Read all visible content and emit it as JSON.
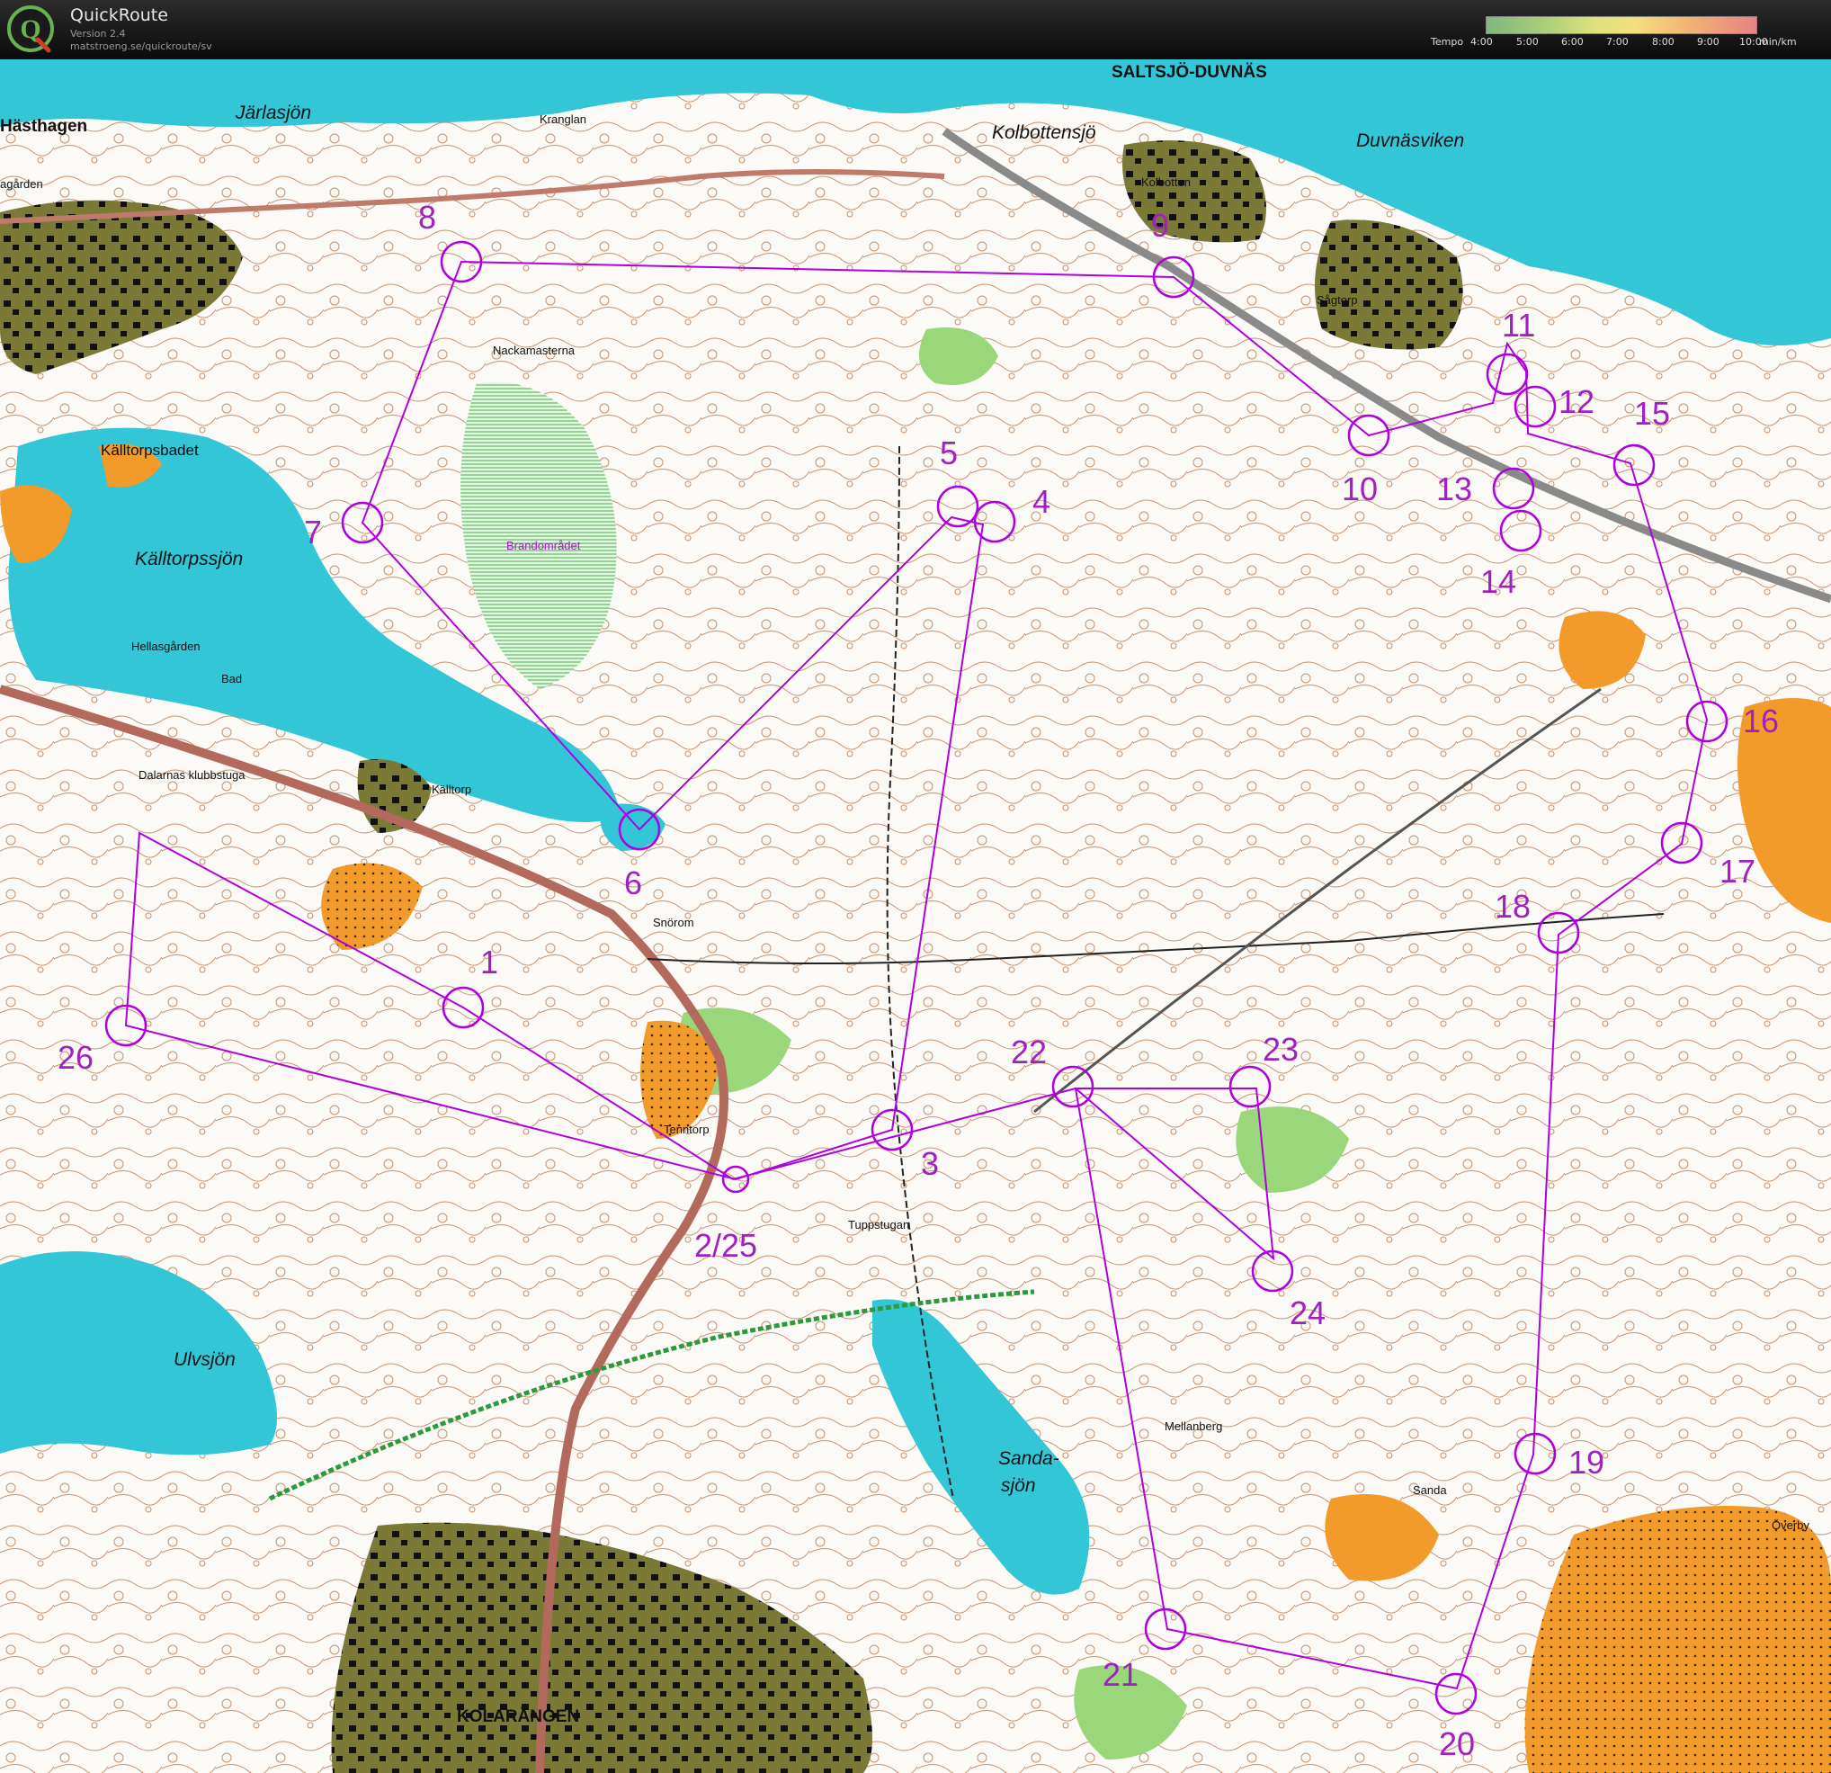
{
  "app": {
    "name": "QuickRoute",
    "version": "Version 2.4",
    "url": "matstroeng.se/quickroute/sv",
    "logo_letter": "Q"
  },
  "tempo_legend": {
    "label": "Tempo",
    "ticks": [
      "4:00",
      "5:00",
      "6:00",
      "7:00",
      "8:00",
      "9:00",
      "10:00"
    ],
    "unit": "min/km",
    "colors": [
      "#7fb77f",
      "#a9cc7a",
      "#dde27a",
      "#f2e07a",
      "#f3b374",
      "#e88282"
    ]
  },
  "map": {
    "colors": {
      "water": "#33c6d6",
      "forest": "#ffffff",
      "green": "#8fd36a",
      "urban": "#6b6b2e",
      "open": "#f29b2a",
      "road": "#c07a6a",
      "course": "#b000e0"
    },
    "place_names": {
      "saltsjo_duvnas": "SALTSJÖ-DUVNÄS",
      "hasthagen": "Hästhagen",
      "kolarangen": "KOLARÄNGEN",
      "kranglan": "Kranglan",
      "nackamasterna": "Nackamasterna",
      "kolbotten": "Kolbotten",
      "sagtorp": "Sågtorp",
      "hellasgarden": "Hellasgården",
      "bad": "Bad",
      "klubbstuga": "Dalarnas klubbstuga",
      "kalltorp": "Källtorp",
      "kalltorpsbadet": "Källtorpsbadet",
      "snorom": "Snörom",
      "tenntorp": "Tenntorp",
      "tuppstugan": "Tuppstugan",
      "mellanberg": "Mellanberg",
      "sanda": "Sanda",
      "overby": "Överby",
      "brandomradet": "Brandområdet",
      "agarden": "agården",
      "hasthagsvagen": "Hästhagsvägen"
    },
    "water_names": {
      "jarlasjon": "Järlasjön",
      "kolbottensjo": "Kolbottensjö",
      "duvnasviken": "Duvnäsviken",
      "kalltorpssjon": "Källtorpssjön",
      "ulvsjon": "Ulvsjön",
      "sandasjon_1": "Sanda-",
      "sandasjon_2": "sjön"
    },
    "controls": [
      {
        "num": "1"
      },
      {
        "num": "3"
      },
      {
        "num": "4"
      },
      {
        "num": "5"
      },
      {
        "num": "6"
      },
      {
        "num": "7"
      },
      {
        "num": "8"
      },
      {
        "num": "9"
      },
      {
        "num": "10"
      },
      {
        "num": "11"
      },
      {
        "num": "12"
      },
      {
        "num": "13"
      },
      {
        "num": "14"
      },
      {
        "num": "15"
      },
      {
        "num": "16"
      },
      {
        "num": "17"
      },
      {
        "num": "18"
      },
      {
        "num": "19"
      },
      {
        "num": "20"
      },
      {
        "num": "21"
      },
      {
        "num": "22"
      },
      {
        "num": "23"
      },
      {
        "num": "24"
      },
      {
        "num": "26"
      },
      {
        "num": "2/25"
      }
    ]
  }
}
